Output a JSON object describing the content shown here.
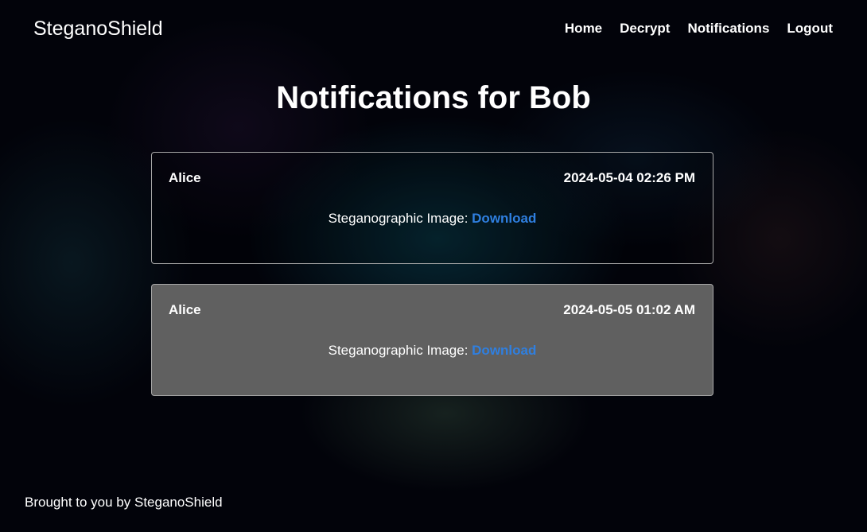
{
  "navbar": {
    "brand": "SteganoShield",
    "links": [
      {
        "label": "Home"
      },
      {
        "label": "Decrypt"
      },
      {
        "label": "Notifications"
      },
      {
        "label": "Logout"
      }
    ]
  },
  "page": {
    "title": "Notifications for Bob"
  },
  "notifications": [
    {
      "sender": "Alice",
      "timestamp": "2024-05-04 02:26 PM",
      "attachment_label": "Steganographic Image:",
      "link_label": "Download"
    },
    {
      "sender": "Alice",
      "timestamp": "2024-05-05 01:02 AM",
      "attachment_label": "Steganographic Image:",
      "link_label": "Download"
    }
  ],
  "footer": {
    "text": "Brought to you by SteganoShield"
  },
  "colors": {
    "link": "#2f7fe0",
    "card_highlight": "#606060",
    "card_border": "#a8a8a8",
    "background": "#02030a"
  }
}
